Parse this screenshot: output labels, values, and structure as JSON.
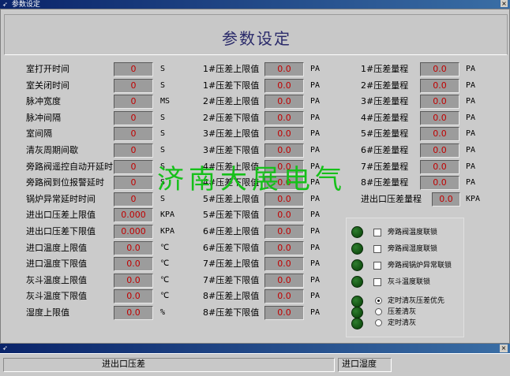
{
  "window": {
    "title": "参数设定",
    "close_label": "×"
  },
  "heading": "参数设定",
  "watermark": "济南大展电气",
  "col1": [
    {
      "label": "室打开时间",
      "value": "0",
      "unit": "S"
    },
    {
      "label": "室关闭时间",
      "value": "0",
      "unit": "S"
    },
    {
      "label": "脉冲宽度",
      "value": "0",
      "unit": "MS"
    },
    {
      "label": "脉冲间隔",
      "value": "0",
      "unit": "S"
    },
    {
      "label": "室间隔",
      "value": "0",
      "unit": "S"
    },
    {
      "label": "清灰周期间歇",
      "value": "0",
      "unit": "S"
    },
    {
      "label": "旁路阀遥控自动开延时",
      "value": "0",
      "unit": "S"
    },
    {
      "label": "旁路阀到位报警延时",
      "value": "0",
      "unit": "S"
    },
    {
      "label": "锅炉异常延时时间",
      "value": "0",
      "unit": "S"
    },
    {
      "label": "进出口压差上限值",
      "value": "0.000",
      "unit": "KPA"
    },
    {
      "label": "进出口压差下限值",
      "value": "0.000",
      "unit": "KPA"
    },
    {
      "label": "进口温度上限值",
      "value": "0.0",
      "unit": "℃"
    },
    {
      "label": "进口温度下限值",
      "value": "0.0",
      "unit": "℃"
    },
    {
      "label": "灰斗温度上限值",
      "value": "0.0",
      "unit": "℃"
    },
    {
      "label": "灰斗温度下限值",
      "value": "0.0",
      "unit": "℃"
    },
    {
      "label": "湿度上限值",
      "value": "0.0",
      "unit": "%"
    }
  ],
  "col2": [
    {
      "label": "1#压差上限值",
      "value": "0.0",
      "unit": "PA"
    },
    {
      "label": "1#压差下限值",
      "value": "0.0",
      "unit": "PA"
    },
    {
      "label": "2#压差上限值",
      "value": "0.0",
      "unit": "PA"
    },
    {
      "label": "2#压差下限值",
      "value": "0.0",
      "unit": "PA"
    },
    {
      "label": "3#压差上限值",
      "value": "0.0",
      "unit": "PA"
    },
    {
      "label": "3#压差下限值",
      "value": "0.0",
      "unit": "PA"
    },
    {
      "label": "4#压差上限值",
      "value": "0.0",
      "unit": "PA"
    },
    {
      "label": "4#压差下限值",
      "value": "0.0",
      "unit": "PA"
    },
    {
      "label": "5#压差上限值",
      "value": "0.0",
      "unit": "PA"
    },
    {
      "label": "5#压差下限值",
      "value": "0.0",
      "unit": "PA"
    },
    {
      "label": "6#压差上限值",
      "value": "0.0",
      "unit": "PA"
    },
    {
      "label": "6#压差下限值",
      "value": "0.0",
      "unit": "PA"
    },
    {
      "label": "7#压差上限值",
      "value": "0.0",
      "unit": "PA"
    },
    {
      "label": "7#压差下限值",
      "value": "0.0",
      "unit": "PA"
    },
    {
      "label": "8#压差上限值",
      "value": "0.0",
      "unit": "PA"
    },
    {
      "label": "8#压差下限值",
      "value": "0.0",
      "unit": "PA"
    }
  ],
  "col3": [
    {
      "label": "1#压差量程",
      "value": "0.0",
      "unit": "PA"
    },
    {
      "label": "2#压差量程",
      "value": "0.0",
      "unit": "PA"
    },
    {
      "label": "3#压差量程",
      "value": "0.0",
      "unit": "PA"
    },
    {
      "label": "4#压差量程",
      "value": "0.0",
      "unit": "PA"
    },
    {
      "label": "5#压差量程",
      "value": "0.0",
      "unit": "PA"
    },
    {
      "label": "6#压差量程",
      "value": "0.0",
      "unit": "PA"
    },
    {
      "label": "7#压差量程",
      "value": "0.0",
      "unit": "PA"
    },
    {
      "label": "8#压差量程",
      "value": "0.0",
      "unit": "PA"
    },
    {
      "label": "进出口压差量程",
      "value": "0.0",
      "unit": "KPA"
    }
  ],
  "interlocks": {
    "checkboxes": [
      {
        "label": "旁路阀温度联锁"
      },
      {
        "label": "旁路阀湿度联锁"
      },
      {
        "label": "旁路阀锅炉异常联锁"
      },
      {
        "label": "灰斗温度联锁"
      }
    ],
    "radios": [
      {
        "label": "定时清灰压差优先",
        "selected": true
      },
      {
        "label": "压差清灰",
        "selected": false
      },
      {
        "label": "定时清灰",
        "selected": false
      }
    ]
  },
  "bottom": {
    "label1": "进出口压差",
    "label2": "进口湿度"
  }
}
